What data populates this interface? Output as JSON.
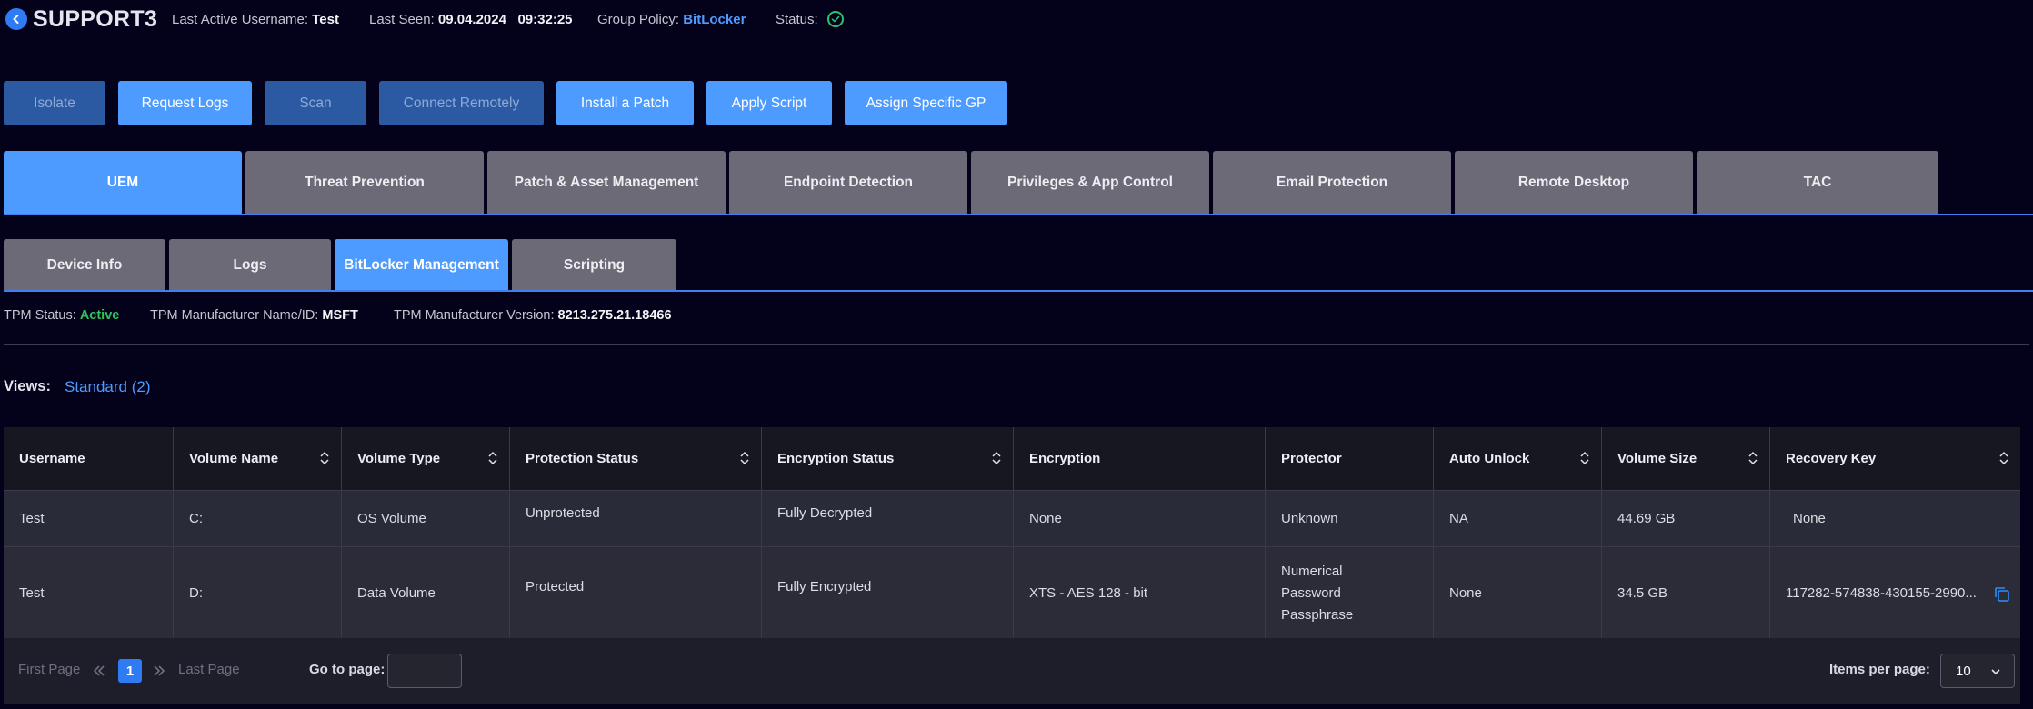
{
  "header": {
    "title": "SUPPORT3",
    "last_active_label": "Last Active Username:",
    "last_active_value": "Test",
    "last_seen_label": "Last Seen:",
    "last_seen_value": "09.04.2024   09:32:25",
    "group_policy_label": "Group Policy:",
    "group_policy_value": "BitLocker",
    "status_label": "Status:",
    "status_icon": "check-circle-icon"
  },
  "actions": [
    "Isolate",
    "Request Logs",
    "Scan",
    "Connect Remotely",
    "Install a Patch",
    "Apply Script",
    "Assign Specific GP"
  ],
  "main_tabs": [
    "UEM",
    "Threat Prevention",
    "Patch & Asset Management",
    "Endpoint Detection",
    "Privileges & App Control",
    "Email Protection",
    "Remote Desktop",
    "TAC"
  ],
  "sub_tabs": [
    "Device Info",
    "Logs",
    "BitLocker Management",
    "Scripting"
  ],
  "tpm": {
    "status_label": "TPM Status:",
    "status_value": "Active",
    "manufacturer_label": "TPM Manufacturer Name/ID:",
    "manufacturer_value": "MSFT",
    "version_label": "TPM Manufacturer Version:",
    "version_value": "8213.275.21.18466"
  },
  "views": {
    "label": "Views:",
    "value": "Standard (2)"
  },
  "table": {
    "columns": [
      "Username",
      "Volume Name",
      "Volume Type",
      "Protection Status",
      "Encryption Status",
      "Encryption",
      "Protector",
      "Auto Unlock",
      "Volume Size",
      "Recovery Key"
    ],
    "rows": [
      {
        "username": "Test",
        "volume_name": "C:",
        "volume_type": "OS Volume",
        "protection_status": "Unprotected",
        "encryption_status": "Fully Decrypted",
        "encryption": "None",
        "protector": [
          "Unknown"
        ],
        "auto_unlock": "NA",
        "volume_size": "44.69 GB",
        "recovery_key": "None"
      },
      {
        "username": "Test",
        "volume_name": "D:",
        "volume_type": "Data Volume",
        "protection_status": "Protected",
        "encryption_status": "Fully Encrypted",
        "encryption": "XTS - AES 128 - bit",
        "protector": [
          "Numerical",
          "Password",
          "Passphrase"
        ],
        "auto_unlock": "None",
        "volume_size": "34.5 GB",
        "recovery_key": "117282-574838-430155-2990..."
      }
    ]
  },
  "pager": {
    "first_page": "First Page",
    "current_page": "1",
    "last_page": "Last Page",
    "go_to_label": "Go to page:",
    "go_to_value": "",
    "items_per_page_label": "Items per page:",
    "items_per_page_value": "10"
  },
  "colors": {
    "accent": "#4d9bff",
    "background": "#03021a",
    "active_green": "#31c05b",
    "tab_gray": "#6b6a76"
  }
}
